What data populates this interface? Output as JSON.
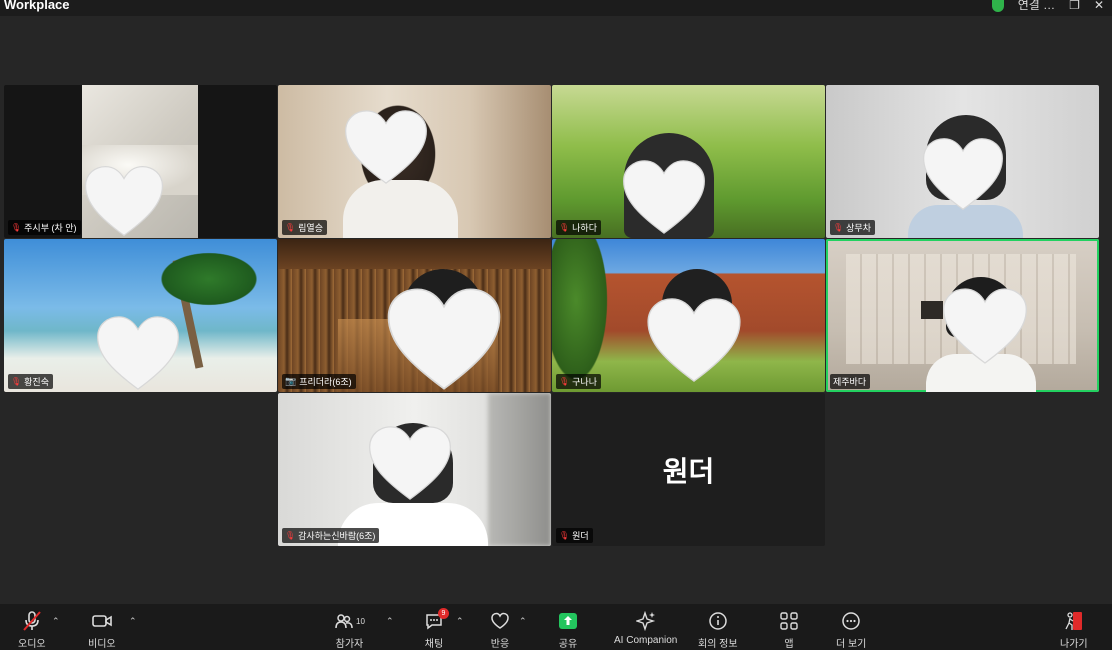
{
  "app": {
    "title": "Workplace",
    "status_text": "연결 …"
  },
  "gallery": {
    "tiles": [
      {
        "name": "주시부 (차 안)",
        "muted": true
      },
      {
        "name": "림열승",
        "muted": true
      },
      {
        "name": "나하다",
        "muted": true
      },
      {
        "name": "상무차",
        "muted": true
      },
      {
        "name": "황진숙",
        "muted": true
      },
      {
        "name": "프리더라(6조)",
        "muted": false
      },
      {
        "name": "구나나",
        "muted": true
      },
      {
        "name": "제주바다",
        "muted": false,
        "active": true
      },
      {
        "name": "감사하는신바람(6조)",
        "muted": true
      },
      {
        "name": "원더",
        "muted": true,
        "video_off": true,
        "display_name": "원더"
      }
    ]
  },
  "toolbar": {
    "audio": "오디오",
    "video": "비디오",
    "participants": "참가자",
    "participants_count": "10",
    "chat": "채팅",
    "chat_badge": "9",
    "reactions": "반응",
    "share": "공유",
    "ai_companion": "AI Companion",
    "meeting_info": "회의 정보",
    "apps": "앱",
    "more": "더 보기",
    "leave": "나가기"
  },
  "colors": {
    "active_speaker": "#23d160",
    "leave": "#e02a2a",
    "share": "#23c55e"
  }
}
